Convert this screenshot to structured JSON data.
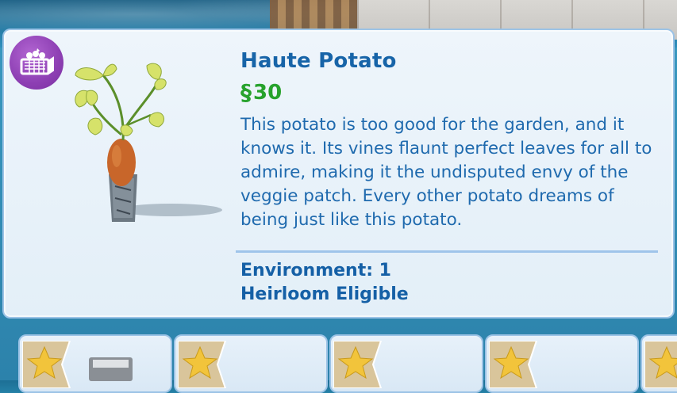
{
  "item": {
    "name": "Haute Potato",
    "currency_symbol": "§",
    "price": "30",
    "description": "This potato is too good for the garden, and it knows it. Its vines flaunt perfect leaves for all to admire, making it the undisputed envy of the veggie patch. Every other potato dreams of being just like this potato.",
    "stats": {
      "environment": "Environment: 1",
      "heirloom": "Heirloom Eligible"
    },
    "category_icon": "garden-basket-icon"
  },
  "colors": {
    "title": "#1764a8",
    "price": "#27a22c",
    "badge": "#8d3fb3",
    "panel_border": "#9cc3e6",
    "star": "#f2c43b"
  },
  "catalog_row": {
    "tiles": [
      {
        "icon": "star-icon"
      },
      {
        "icon": "star-icon"
      },
      {
        "icon": "star-icon"
      },
      {
        "icon": "star-icon"
      },
      {
        "icon": "star-icon"
      }
    ]
  }
}
